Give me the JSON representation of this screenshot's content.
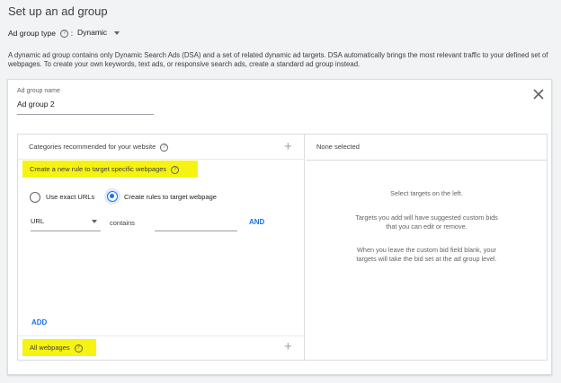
{
  "page": {
    "title": "Set up an ad group",
    "ad_group_type_label": "Ad group type",
    "ad_group_type_value": "Dynamic",
    "description": "A dynamic ad group contains only Dynamic Search Ads (DSA) and a set of related dynamic ad targets. DSA automatically brings the most relevant traffic to your defined set of webpages. To create your own keywords, text ads, or responsive search ads, create a standard ad group instead."
  },
  "card": {
    "name_label": "Ad group name",
    "name_value": "Ad group 2",
    "left": {
      "categories_label": "Categories recommended for your website",
      "create_rule_label": "Create a new rule to target specific webpages",
      "radio_exact": "Use exact URLs",
      "radio_rules": "Create rules to target webpage",
      "selected_radio": "Create rules to target webpage",
      "field_select": "URL",
      "operator": "contains",
      "and_label": "AND",
      "add_label": "ADD",
      "all_webpages_label": "All webpages"
    },
    "right": {
      "header": "None selected",
      "line1": "Select targets on the left.",
      "line2a": "Targets you add will have suggested custom bids",
      "line2b": "that you can edit or remove.",
      "line3a": "When you leave the custom bid field blank, your",
      "line3b": "targets will take the bid set at the ad group level."
    }
  },
  "colors": {
    "accent": "#1a73e8",
    "highlight": "#f7f311",
    "background": "#f1f3f4"
  },
  "icons": [
    "help-icon",
    "chevron-down-icon",
    "close-icon",
    "plus-icon"
  ]
}
